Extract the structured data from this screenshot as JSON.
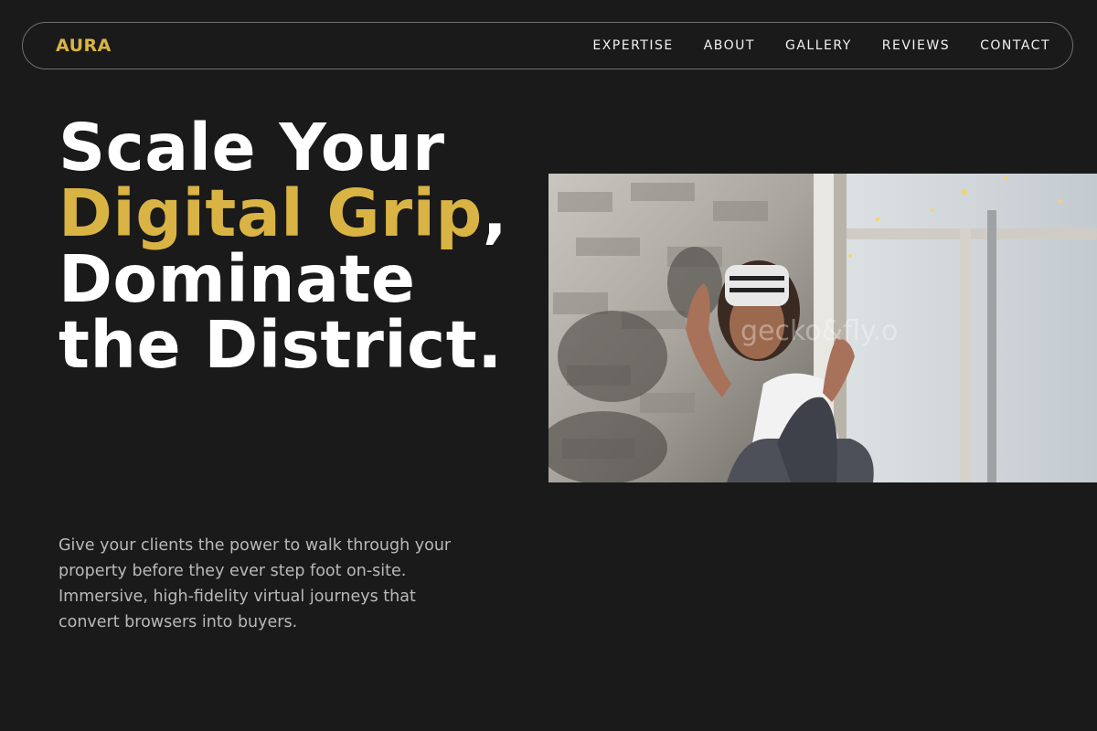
{
  "nav": {
    "logo": "AURA",
    "links": [
      "EXPERTISE",
      "ABOUT",
      "GALLERY",
      "REVIEWS",
      "CONTACT"
    ]
  },
  "hero": {
    "title_line1": "Scale Your",
    "title_accent": "Digital Grip",
    "title_comma": ",",
    "title_rest": "Dominate the District.",
    "subtitle": "Give your clients the power to walk through your property before they ever step foot on-site. Immersive, high-fidelity virtual journeys that convert browsers into buyers.",
    "image_watermark": "gecko&fly.o"
  },
  "colors": {
    "background": "#1a1a1a",
    "accent": "#d9b444",
    "text": "#ffffff",
    "muted": "#b9b9b9"
  }
}
